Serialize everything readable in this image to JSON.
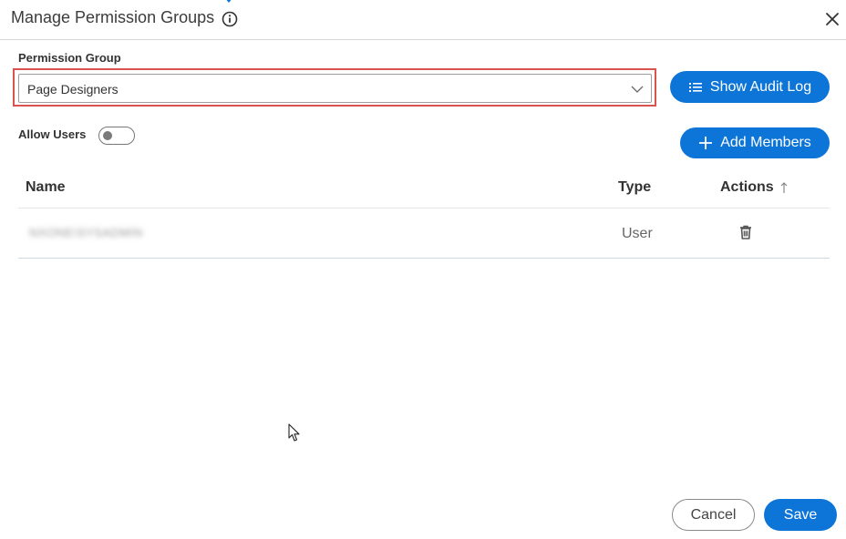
{
  "dialog": {
    "title": "Manage Permission Groups",
    "close_icon": "close-icon",
    "info_icon": "info-icon"
  },
  "permission_group": {
    "label": "Permission Group",
    "selected": "Page Designers"
  },
  "toolbar": {
    "audit_label": "Show Audit Log",
    "add_label": "Add Members"
  },
  "allow_users": {
    "label": "Allow Users",
    "enabled": false
  },
  "table": {
    "columns": [
      "Name",
      "Type",
      "Actions"
    ],
    "rows": [
      {
        "name": "NXONE\\SYSADMIN",
        "type": "User"
      }
    ]
  },
  "footer": {
    "cancel_label": "Cancel",
    "save_label": "Save"
  },
  "colors": {
    "primary": "#0d74d8",
    "highlight_border": "#d9534f"
  }
}
